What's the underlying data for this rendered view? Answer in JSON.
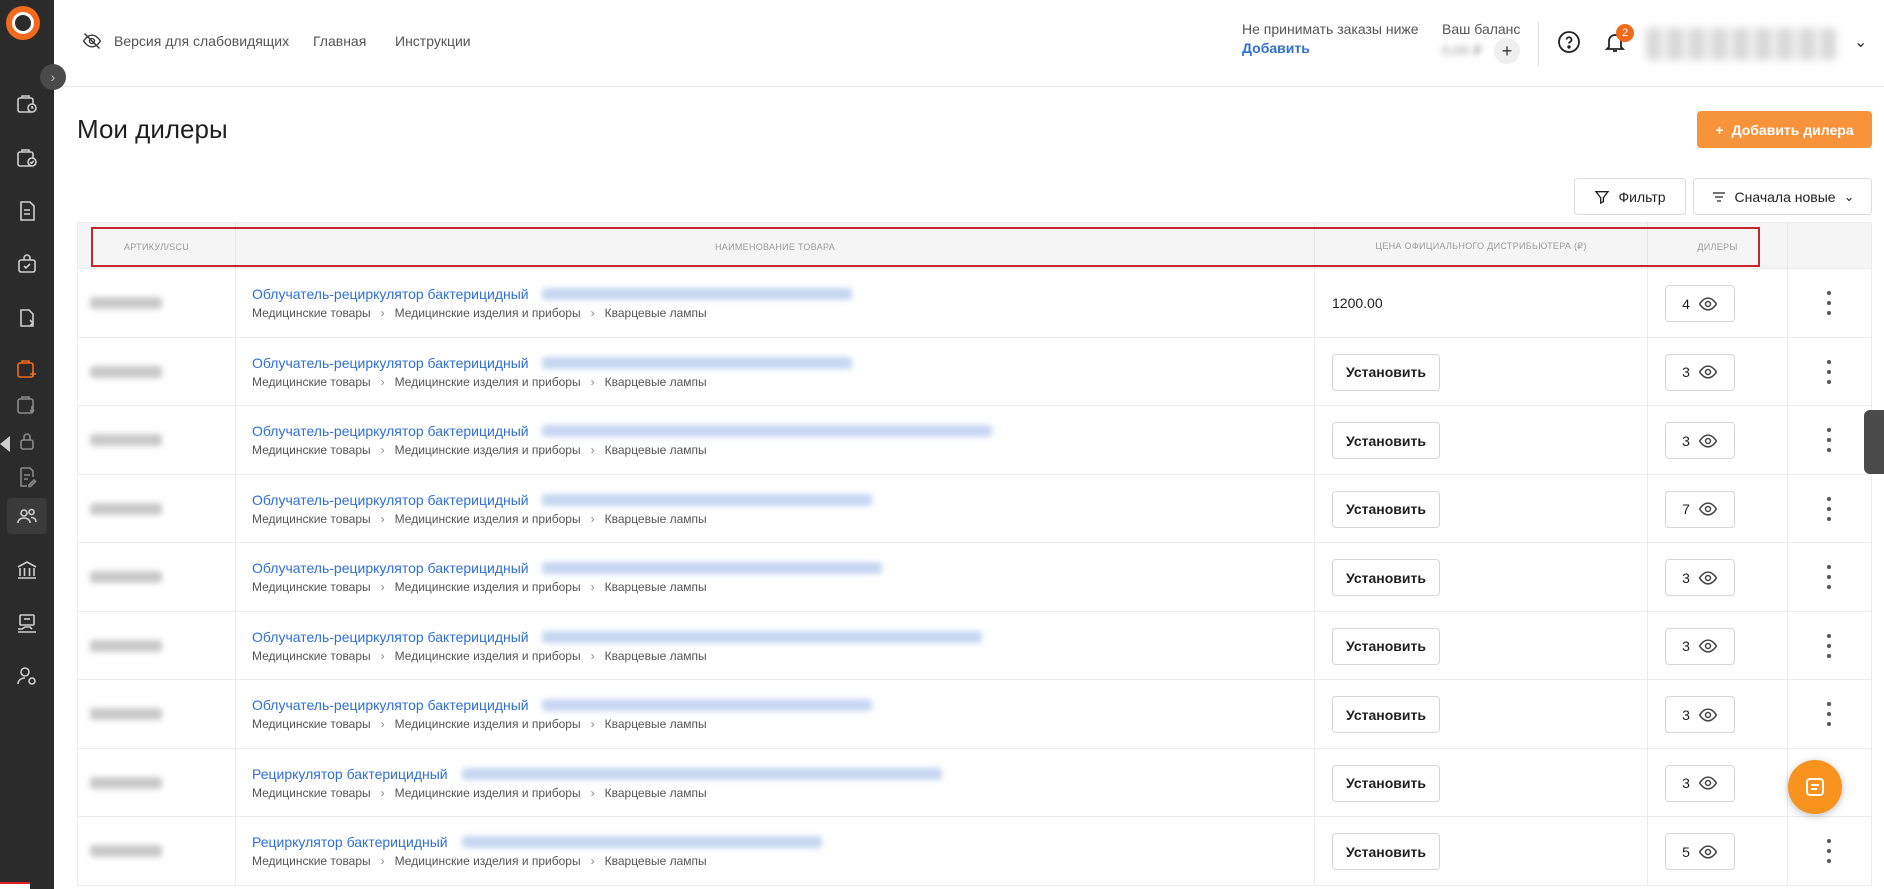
{
  "topbar": {
    "accessibility": "Версия для слабовидящих",
    "home": "Главная",
    "instructions": "Инструкции",
    "orders_label": "Не принимать заказы ниже",
    "orders_link": "Добавить",
    "balance_label": "Ваш баланс",
    "balance_value": "0,00 ₽",
    "balance_plus": "+",
    "notifications_count": "2"
  },
  "page": {
    "title": "Мои дилеры",
    "add_button": "Добавить дилера",
    "filter_button": "Фильтр",
    "sort_button": "Сначала новые"
  },
  "table": {
    "headers": {
      "sku": "АРТИКУЛ/SCU",
      "name": "НАИМЕНОВАНИЕ ТОВАРА",
      "price": "ЦЕНА ОФИЦИАЛЬНОГО ДИСТРИБЬЮТЕРА (₽)",
      "dealers": "ДИЛЕРЫ"
    },
    "breadcrumb": [
      "Медицинские товары",
      "Медицинские изделия и приборы",
      "Кварцевые лампы"
    ],
    "install_label": "Установить",
    "rows": [
      {
        "title": "Облучатель-рециркулятор бактерицидный",
        "price": "1200.00",
        "dealers": "4"
      },
      {
        "title": "Облучатель-рециркулятор бактерицидный",
        "price": "",
        "dealers": "3"
      },
      {
        "title": "Облучатель-рециркулятор бактерицидный",
        "price": "",
        "dealers": "3"
      },
      {
        "title": "Облучатель-рециркулятор бактерицидный",
        "price": "",
        "dealers": "7"
      },
      {
        "title": "Облучатель-рециркулятор бактерицидный",
        "price": "",
        "dealers": "3"
      },
      {
        "title": "Облучатель-рециркулятор бактерицидный",
        "price": "",
        "dealers": "3"
      },
      {
        "title": "Облучатель-рециркулятор бактерицидный",
        "price": "",
        "dealers": "3"
      },
      {
        "title": "Рециркулятор бактерицидный",
        "price": "",
        "dealers": "3"
      },
      {
        "title": "Рециркулятор бактерицидный",
        "price": "",
        "dealers": "5"
      }
    ]
  },
  "colors": {
    "accent": "#f7933a",
    "link": "#2f6fd6",
    "sidebar": "#2b2b2b",
    "highlight_outline": "#c4262e"
  }
}
